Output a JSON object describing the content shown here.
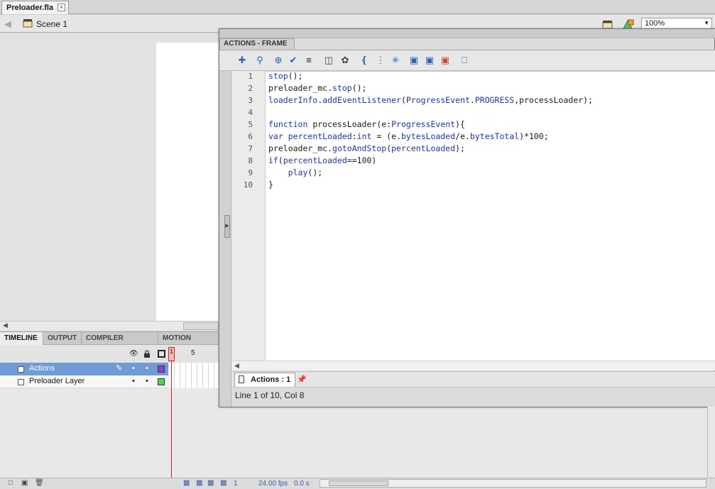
{
  "document": {
    "tab_title": "Preloader.fla",
    "close_glyph": "×"
  },
  "editbar": {
    "scene_label": "Scene 1",
    "zoom": "100%"
  },
  "timeline": {
    "tabs": [
      "TIMELINE",
      "OUTPUT",
      "COMPILER ERRORS",
      "MOTION EDITOR"
    ],
    "current_frame_label": "1",
    "frame_marker_5": "5",
    "layers": [
      {
        "name": "Actions",
        "color": "#8e3fd6",
        "selected": true
      },
      {
        "name": "Preloader Layer",
        "color": "#4ed84e",
        "selected": false
      }
    ],
    "footer": {
      "frame": "1",
      "fps_value": "24.00",
      "fps_unit": "fps",
      "time_value": "0.0",
      "time_unit": "s"
    }
  },
  "actions_panel": {
    "title": "ACTIONS - FRAME",
    "code_lines": [
      {
        "n": "1",
        "text": "stop();"
      },
      {
        "n": "2",
        "text": "preloader_mc.stop();"
      },
      {
        "n": "3",
        "text": "loaderInfo.addEventListener(ProgressEvent.PROGRESS,processLoader);"
      },
      {
        "n": "4",
        "text": ""
      },
      {
        "n": "5",
        "text": "function processLoader(e:ProgressEvent){"
      },
      {
        "n": "6",
        "text": "var percentLoaded:int = (e.bytesLoaded/e.bytesTotal)*100;"
      },
      {
        "n": "7",
        "text": "preloader_mc.gotoAndStop(percentLoaded);"
      },
      {
        "n": "8",
        "text": "if(percentLoaded==100)"
      },
      {
        "n": "9",
        "text": "    play();"
      },
      {
        "n": "10",
        "text": "}"
      }
    ],
    "script_tab": "Actions : 1",
    "status": "Line 1 of 10, Col 8"
  },
  "colors": {
    "keyword": "#1a34c9",
    "selected_layer": "#6f9bd6",
    "playhead": "#e02020"
  }
}
